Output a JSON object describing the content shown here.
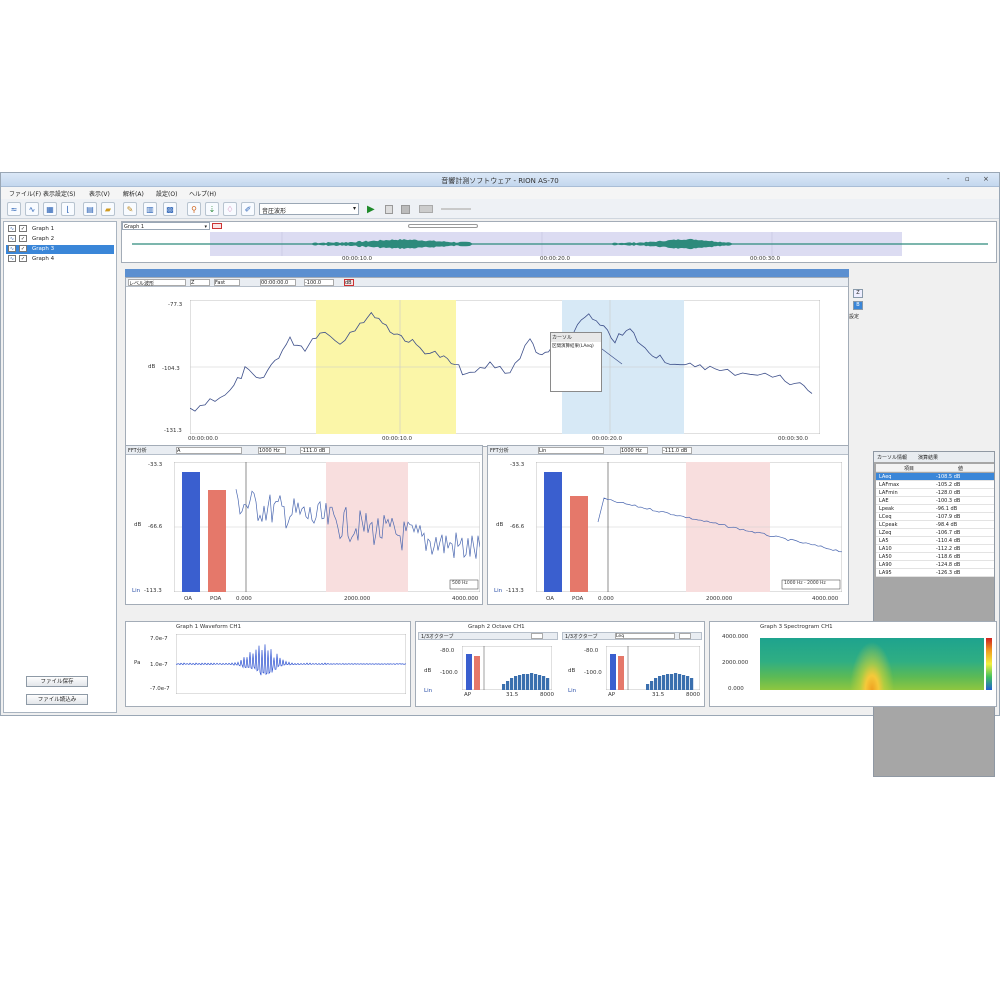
{
  "window": {
    "title": "音響計測ソフトウェア - RION AS-70",
    "minimize": "-",
    "restore": "▫",
    "close": "×"
  },
  "menu": [
    "ファイル(F)",
    "表示設定(S)",
    "表示(V)",
    "解析(A)",
    "設定(O)",
    "ヘルプ(H)"
  ],
  "toolbar": {
    "combo_value": "音圧波形",
    "icons": [
      "wave-icon",
      "sine-icon",
      "chart-icon",
      "graph-icon",
      "folder-open-icon",
      "folder-icon",
      "cursor-icon",
      "bar-chart-icon",
      "spectrum-icon",
      "play-icon",
      "marker-icon",
      "marker2-icon",
      "edit-icon"
    ]
  },
  "sidebar": {
    "items": [
      {
        "label": "Graph 1",
        "selected": false
      },
      {
        "label": "Graph 2",
        "selected": false
      },
      {
        "label": "Graph 3",
        "selected": true
      },
      {
        "label": "Graph 4",
        "selected": false
      }
    ],
    "button1": "ファイル保存",
    "button2": "ファイル読込み"
  },
  "overview": {
    "label": "Graph 1",
    "time1": "00:00:10.0",
    "time2": "00:00:20.0",
    "time3": "00:00:30.0"
  },
  "main_chart": {
    "header": [
      "レベル波形",
      "Z",
      "Fast",
      "00:00:00.0",
      "-100.0",
      "dB"
    ],
    "y_ticks": [
      "-77.3",
      "-104.3",
      "-131.3"
    ],
    "y_unit": "dB",
    "x_ticks": [
      "00:00:00.0",
      "00:00:10.0",
      "00:00:20.0",
      "00:00:30.0"
    ],
    "popup": [
      "カーソル",
      "区間演算結果(LAeq)"
    ]
  },
  "side_buttons": [
    "Z",
    "B",
    "設定"
  ],
  "result_table": {
    "tabs": [
      "カーソル情報",
      "演算結果"
    ],
    "headers": [
      "項目",
      "値"
    ],
    "rows": [
      [
        "LAeq",
        "-108.5 dB"
      ],
      [
        "LAFmax",
        "-105.2 dB"
      ],
      [
        "LAFmin",
        "-128.0 dB"
      ],
      [
        "LAE",
        "-100.3 dB"
      ],
      [
        "Lpeak",
        "-96.1 dB"
      ],
      [
        "LCeq",
        "-107.9 dB"
      ],
      [
        "LCpeak",
        "-98.4 dB"
      ],
      [
        "LZeq",
        "-106.7 dB"
      ],
      [
        "LA5",
        "-110.4 dB"
      ],
      [
        "LA10",
        "-112.2 dB"
      ],
      [
        "LA50",
        "-118.6 dB"
      ],
      [
        "LA90",
        "-124.8 dB"
      ],
      [
        "LA95",
        "-126.3 dB"
      ]
    ]
  },
  "fft_left": {
    "header": [
      "FFT分析",
      "A",
      "1000 Hz",
      "-111.0 dB"
    ],
    "y_ticks": [
      "-33.3",
      "-66.6",
      "-113.3"
    ],
    "x_ticks": [
      "OA",
      "POA",
      "0.000",
      "2000.000",
      "4000.000"
    ],
    "y_unit": "dB",
    "scale": "Lin",
    "corner": "500 Hz"
  },
  "fft_right": {
    "header": [
      "FFT分析",
      "Lin",
      "1000 Hz",
      "-111.0 dB"
    ],
    "y_ticks": [
      "-33.3",
      "-66.6",
      "-113.3"
    ],
    "x_ticks": [
      "OA",
      "POA",
      "0.000",
      "2000.000",
      "4000.000"
    ],
    "y_unit": "dB",
    "scale": "Lin",
    "corner": "1000 Hz - 2000 Hz"
  },
  "waveform": {
    "title": "Graph 1 Waveform CH1",
    "y_ticks": [
      "7.0e-7",
      "1.0e-7",
      "-7.0e-7"
    ],
    "y_unit": "Pa"
  },
  "octave_left": {
    "title": "Graph 2 Octave CH1",
    "header": "1/3オクターブ",
    "y_ticks": [
      "-80.0",
      "-100.0"
    ],
    "x_ticks": [
      "AP",
      "31.5",
      "8000"
    ],
    "y_unit": "dB",
    "scale": "Lin"
  },
  "octave_right": {
    "header": "1/3オクターブ",
    "combo": "Leq",
    "y_ticks": [
      "-80.0",
      "-100.0"
    ],
    "x_ticks": [
      "AP",
      "31.5",
      "8000"
    ],
    "y_unit": "dB",
    "scale": "Lin"
  },
  "spectrogram": {
    "title": "Graph 3 Spectrogram CH1",
    "y_ticks": [
      "4000.000",
      "2000.000",
      "0.000"
    ]
  },
  "colors": {
    "accent": "#3a86d8",
    "bar_blue": "#3a5fcf",
    "bar_red": "#e5786a",
    "yellow_region": "#fbf6a8",
    "blue_region": "#d7e9f6",
    "pink_region": "#f8dede",
    "line": "#3d4f8a"
  }
}
